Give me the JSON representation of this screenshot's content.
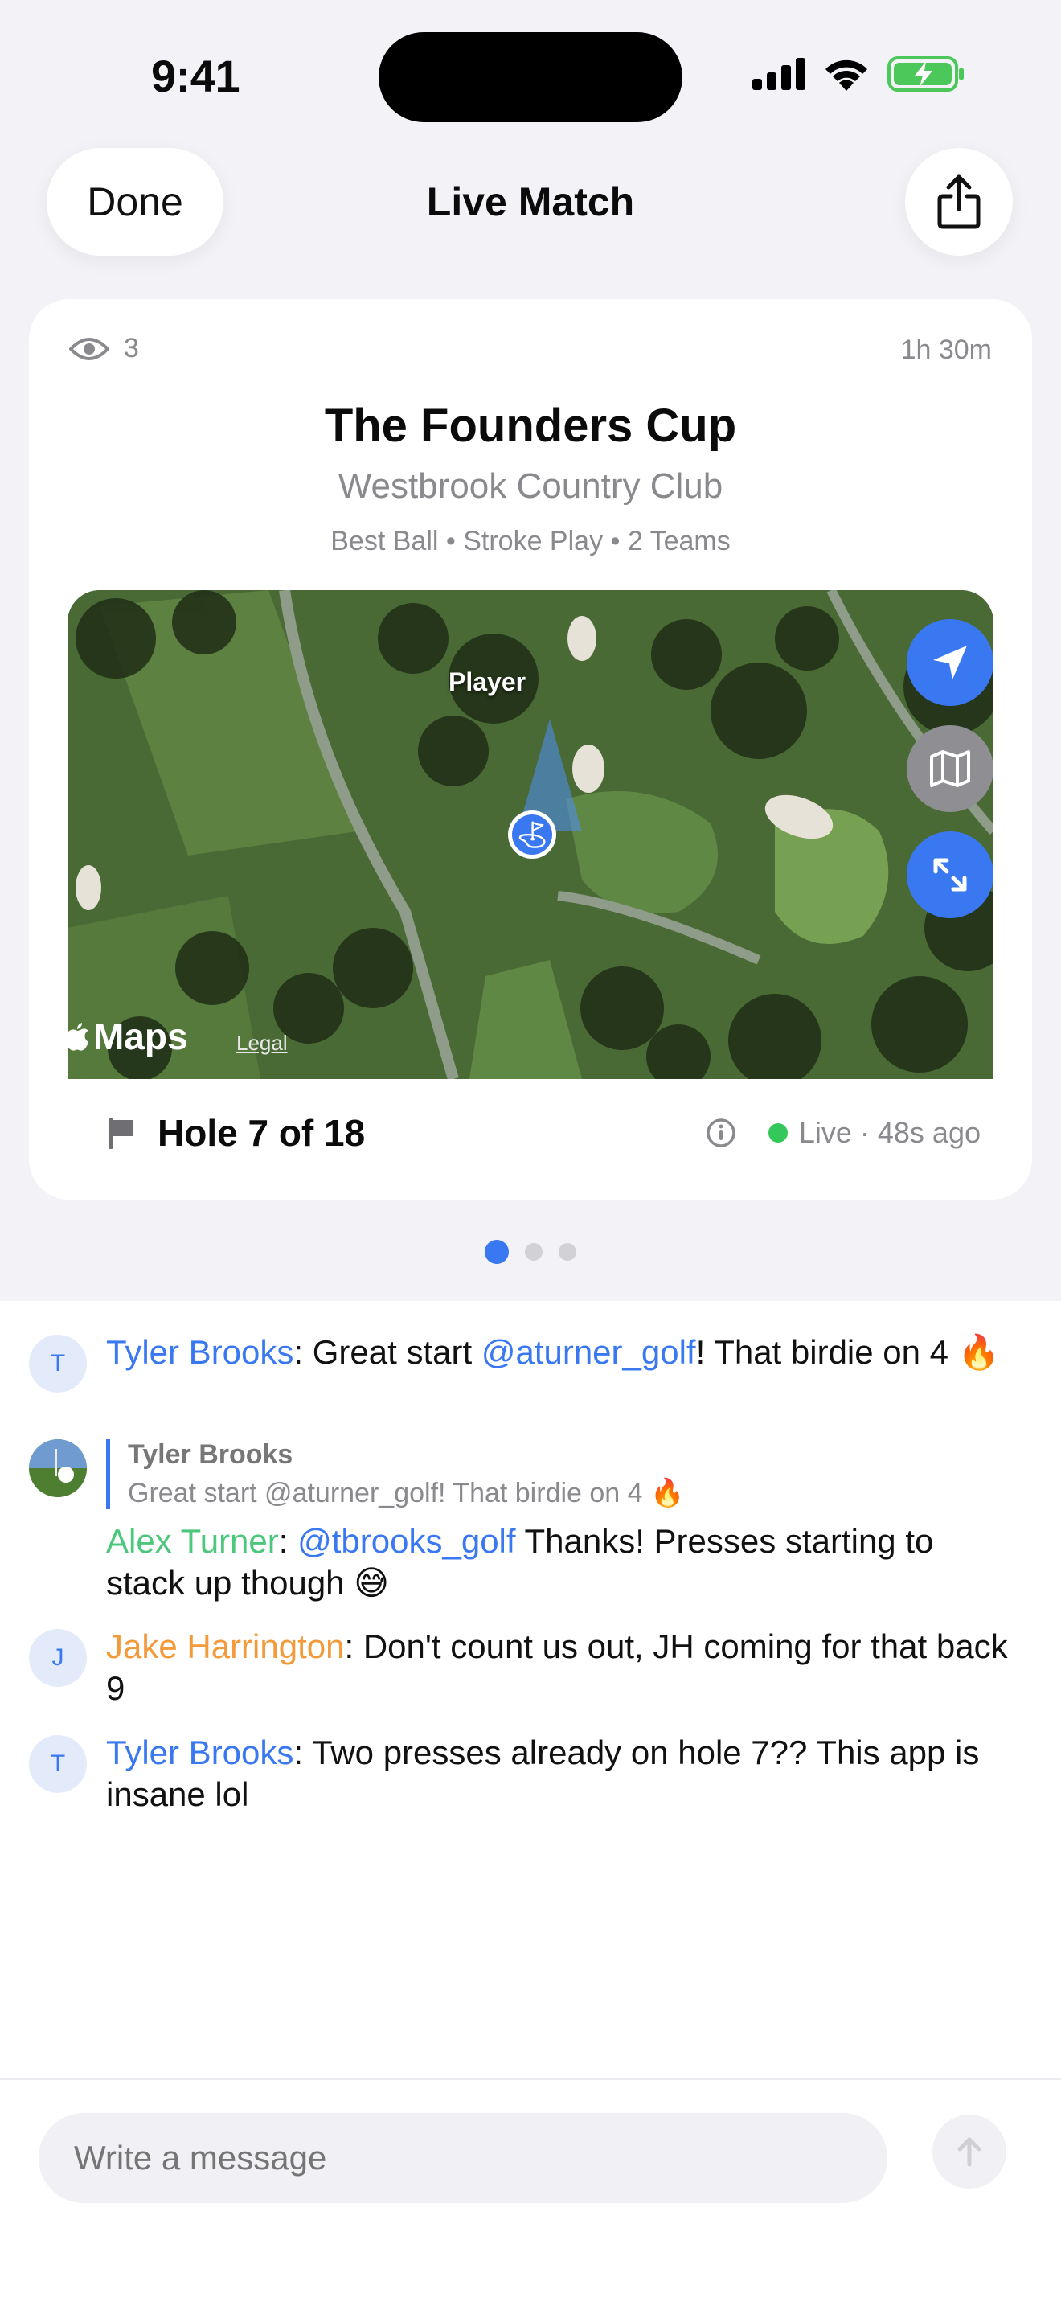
{
  "status_bar": {
    "time": "9:41"
  },
  "nav": {
    "done_label": "Done",
    "title": "Live Match"
  },
  "match": {
    "viewers": "3",
    "duration": "1h 30m",
    "title": "The Founders Cup",
    "club": "Westbrook Country Club",
    "format": "Best Ball • Stroke Play • 2 Teams"
  },
  "map": {
    "player_label": "Player",
    "maps_label": "Maps",
    "legal_label": "Legal"
  },
  "hole": {
    "label": "Hole 7 of 18",
    "live_status": "Live · 48s ago"
  },
  "pager": {
    "count": 3,
    "active_index": 0
  },
  "messages": [
    {
      "avatar": "T",
      "name": "Tyler Brooks",
      "text_before": "Great start ",
      "mention": "@aturner_golf",
      "text_after": "! That birdie on 4 🔥"
    },
    {
      "reply_to": {
        "name": "Tyler Brooks",
        "text": "Great start @aturner_golf! That birdie on 4 🔥"
      },
      "name": "Alex Turner",
      "mention": "@tbrooks_golf",
      "text_after": " Thanks! Presses starting to stack up though 😅"
    },
    {
      "avatar": "J",
      "name": "Jake Harrington",
      "text": "Don't count us out, JH coming for that back 9"
    },
    {
      "avatar": "T",
      "name": "Tyler Brooks",
      "text": "Two presses already on hole 7?? This app is insane lol"
    }
  ],
  "composer": {
    "placeholder": "Write a message"
  },
  "colors": {
    "accent": "#3a78f2",
    "live": "#34c759",
    "name_green": "#4cc77b",
    "name_orange": "#f39a3b"
  }
}
